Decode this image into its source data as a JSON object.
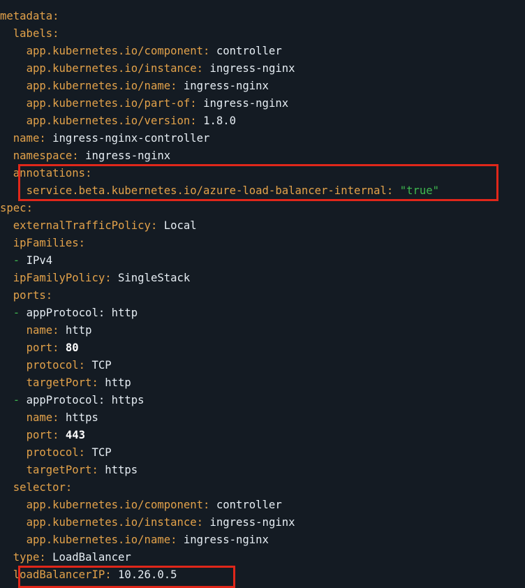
{
  "code": {
    "lines": [
      {
        "indent": "",
        "key": "metadata",
        "colon": ":",
        "value": ""
      },
      {
        "indent": "  ",
        "key": "labels",
        "colon": ":",
        "value": ""
      },
      {
        "indent": "    ",
        "key": "app.kubernetes.io/component",
        "colon": ":",
        "value": "controller"
      },
      {
        "indent": "    ",
        "key": "app.kubernetes.io/instance",
        "colon": ":",
        "value": "ingress-nginx"
      },
      {
        "indent": "    ",
        "key": "app.kubernetes.io/name",
        "colon": ":",
        "value": "ingress-nginx"
      },
      {
        "indent": "    ",
        "key": "app.kubernetes.io/part-of",
        "colon": ":",
        "value": "ingress-nginx"
      },
      {
        "indent": "    ",
        "key": "app.kubernetes.io/version",
        "colon": ":",
        "value": "1.8.0"
      },
      {
        "indent": "  ",
        "key": "name",
        "colon": ":",
        "value": "ingress-nginx-controller"
      },
      {
        "indent": "  ",
        "key": "namespace",
        "colon": ":",
        "value": "ingress-nginx"
      },
      {
        "indent": "  ",
        "key": "annotations",
        "colon": ":",
        "value": ""
      },
      {
        "indent": "    ",
        "key": "service.beta.kubernetes.io/azure-load-balancer-internal",
        "colon": ":",
        "value": "\"true\"",
        "vtype": "str"
      },
      {
        "indent": "",
        "key": "spec",
        "colon": ":",
        "value": ""
      },
      {
        "indent": "  ",
        "key": "externalTrafficPolicy",
        "colon": ":",
        "value": "Local"
      },
      {
        "indent": "  ",
        "key": "ipFamilies",
        "colon": ":",
        "value": ""
      },
      {
        "indent": "  ",
        "dash": "- ",
        "key": "",
        "colon": "",
        "value": "IPv4"
      },
      {
        "indent": "  ",
        "key": "ipFamilyPolicy",
        "colon": ":",
        "value": "SingleStack"
      },
      {
        "indent": "  ",
        "key": "ports",
        "colon": ":",
        "value": ""
      },
      {
        "indent": "  ",
        "dash": "- ",
        "key": "appProtocol",
        "colon": ":",
        "value": "http",
        "vkeyplain": true
      },
      {
        "indent": "    ",
        "key": "name",
        "colon": ":",
        "value": "http"
      },
      {
        "indent": "    ",
        "key": "port",
        "colon": ":",
        "value": "80",
        "vtype": "num"
      },
      {
        "indent": "    ",
        "key": "protocol",
        "colon": ":",
        "value": "TCP"
      },
      {
        "indent": "    ",
        "key": "targetPort",
        "colon": ":",
        "value": "http"
      },
      {
        "indent": "  ",
        "dash": "- ",
        "key": "appProtocol",
        "colon": ":",
        "value": "https",
        "vkeyplain": true
      },
      {
        "indent": "    ",
        "key": "name",
        "colon": ":",
        "value": "https"
      },
      {
        "indent": "    ",
        "key": "port",
        "colon": ":",
        "value": "443",
        "vtype": "num"
      },
      {
        "indent": "    ",
        "key": "protocol",
        "colon": ":",
        "value": "TCP"
      },
      {
        "indent": "    ",
        "key": "targetPort",
        "colon": ":",
        "value": "https"
      },
      {
        "indent": "  ",
        "key": "selector",
        "colon": ":",
        "value": ""
      },
      {
        "indent": "    ",
        "key": "app.kubernetes.io/component",
        "colon": ":",
        "value": "controller"
      },
      {
        "indent": "    ",
        "key": "app.kubernetes.io/instance",
        "colon": ":",
        "value": "ingress-nginx"
      },
      {
        "indent": "    ",
        "key": "app.kubernetes.io/name",
        "colon": ":",
        "value": "ingress-nginx"
      },
      {
        "indent": "  ",
        "key": "type",
        "colon": ":",
        "value": "LoadBalancer"
      },
      {
        "indent": "  ",
        "key": "loadBalancerIP",
        "colon": ":",
        "value": "10.26.0.5"
      }
    ]
  },
  "colors": {
    "background": "#141b23",
    "key": "#e3a24a",
    "value": "#e6edf3",
    "string": "#3fb950",
    "dash": "#3fb950",
    "highlight_box": "#e0271a"
  }
}
